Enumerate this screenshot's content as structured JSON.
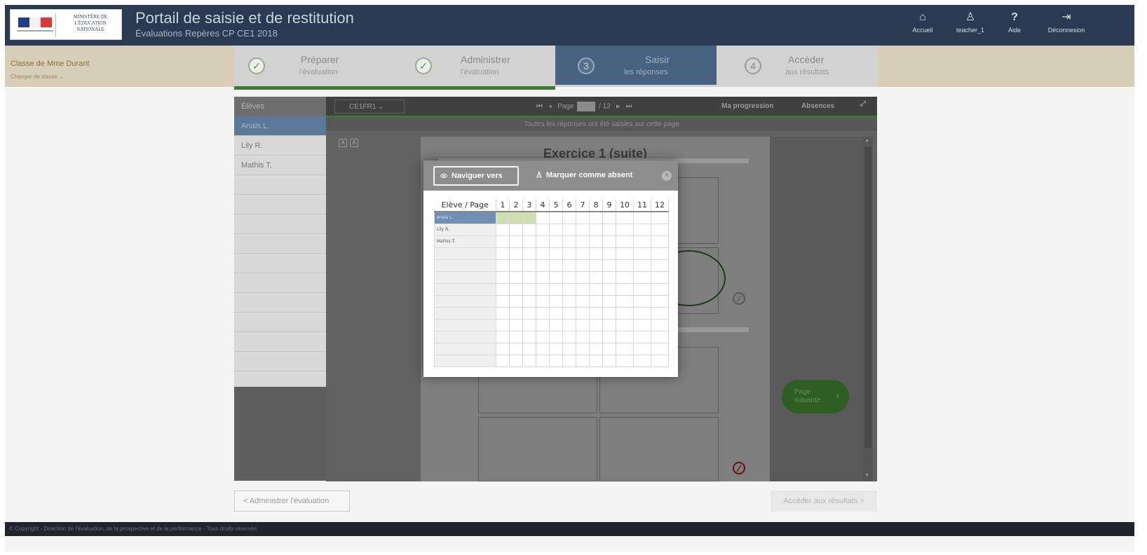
{
  "header": {
    "logo_text": "MINISTÈRE DE L'ÉDUCATION NATIONALE",
    "title": "Portail de saisie et de restitution",
    "subtitle": "Évaluations Repères CP CE1 2018",
    "nav": [
      {
        "label": "Accueil",
        "icon": "home-icon"
      },
      {
        "label": "teacher_1",
        "icon": "user-icon"
      },
      {
        "label": "Aide",
        "icon": "help-icon"
      },
      {
        "label": "Déconnexion",
        "icon": "logout-icon"
      }
    ]
  },
  "class_bar": {
    "name": "Classe de Mme Durant",
    "change_link": "Changer de classe ⌄"
  },
  "stepper": [
    {
      "num": "✓",
      "line1": "Préparer",
      "line2": "l'évaluation",
      "state": "done"
    },
    {
      "num": "✓",
      "line1": "Administrer",
      "line2": "l'évaluation",
      "state": "done"
    },
    {
      "num": "3",
      "line1": "Saisir",
      "line2": "les réponses",
      "state": "active"
    },
    {
      "num": "4",
      "line1": "Accéder",
      "line2": "aux résultats",
      "state": "todo"
    }
  ],
  "students": {
    "header": "Élèves",
    "list": [
      "Anaïs L.",
      "Lily R.",
      "Mathis T."
    ]
  },
  "toolbar": {
    "level_select": "CE1FR1 ⌄",
    "page_label": "Page",
    "page_total": "/ 12",
    "progress_link": "Ma progression",
    "absences_link": "Absences",
    "status": "Toutes les réponses ont été saisies sur cette page"
  },
  "exercise": {
    "title": "Exercice 1 (suite)",
    "next_page": "Page suivante"
  },
  "bottom": {
    "prev_button": "<  Administrer l'évaluation",
    "next_button": "Accéder aux résultats  >"
  },
  "footer": {
    "text": "© Copyright - Direction de l'évaluation, de la prospective et de la performance - Tous droits réservés"
  },
  "modal": {
    "navigate_button": "Naviguer vers",
    "absent_button": "Marquer comme absent",
    "grid_header": "Elève / Page",
    "pages": [
      "1",
      "2",
      "3",
      "4",
      "5",
      "6",
      "7",
      "8",
      "9",
      "10",
      "11",
      "12"
    ],
    "grid_students": [
      "Anaïs L.",
      "Lily R.",
      "Mathis T."
    ],
    "completed": {
      "student": "Anaïs L.",
      "pages": [
        "1",
        "2",
        "3"
      ]
    }
  },
  "colors": {
    "header_bg": "#2a3a52",
    "active_step": "#47627f",
    "progress_green": "#3d7a2f",
    "selected_student": "#5a7898",
    "grid_done": "#cfe0b0"
  }
}
